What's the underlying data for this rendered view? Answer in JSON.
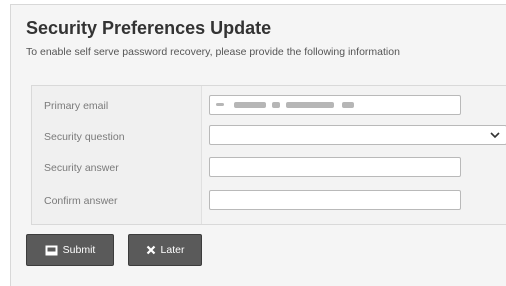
{
  "page": {
    "title": "Security Preferences Update",
    "subtitle": "To enable self serve password recovery, please provide the following information"
  },
  "form": {
    "primary_email_label": "Primary email",
    "primary_email_value": "",
    "security_question_label": "Security question",
    "security_question_value": "",
    "security_answer_label": "Security answer",
    "security_answer_value": "",
    "confirm_answer_label": "Confirm answer",
    "confirm_answer_value": ""
  },
  "buttons": {
    "submit_label": "Submit",
    "later_label": "Later"
  },
  "colors": {
    "button_bg": "#5a5a5a",
    "panel_bg": "#f5f5f5"
  },
  "icons": {
    "submit": "save-icon",
    "later": "close-icon",
    "select": "chevron-down-icon"
  }
}
